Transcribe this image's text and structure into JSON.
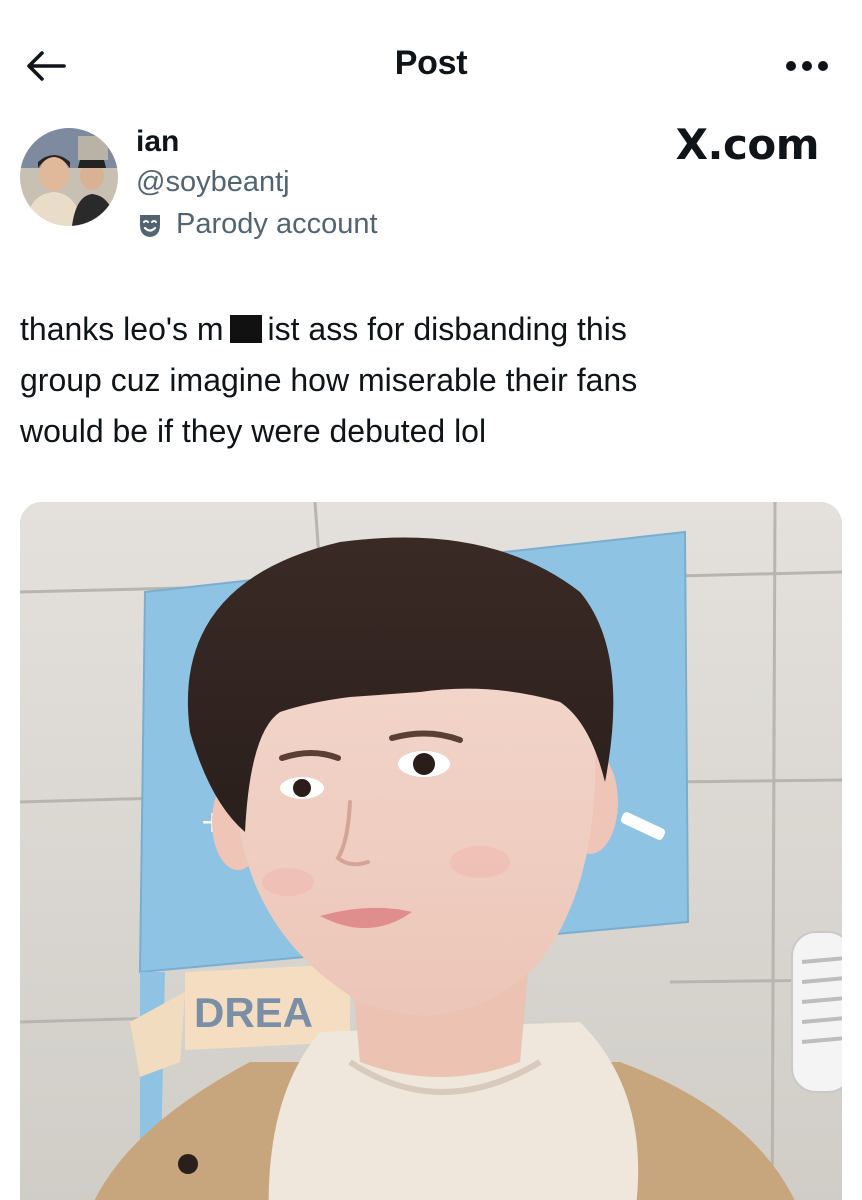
{
  "header": {
    "title": "Post",
    "back_icon": "arrow-left-icon",
    "more_icon": "more-horizontal-icon"
  },
  "author": {
    "name": "ian",
    "handle": "@soybeantj",
    "label": "Parody account",
    "label_icon": "theater-mask-icon"
  },
  "watermark": "X.com",
  "post": {
    "text_part1": "thanks leo's m",
    "text_part2": "ist ass for disbanding this\ngroup cuz imagine how miserable their fans\nwould be if they were debuted lol"
  },
  "media": {
    "poster_text": "DREA"
  },
  "colors": {
    "text": "#0f1419",
    "secondary": "#536471",
    "poster_blue": "#8fc3e3"
  }
}
